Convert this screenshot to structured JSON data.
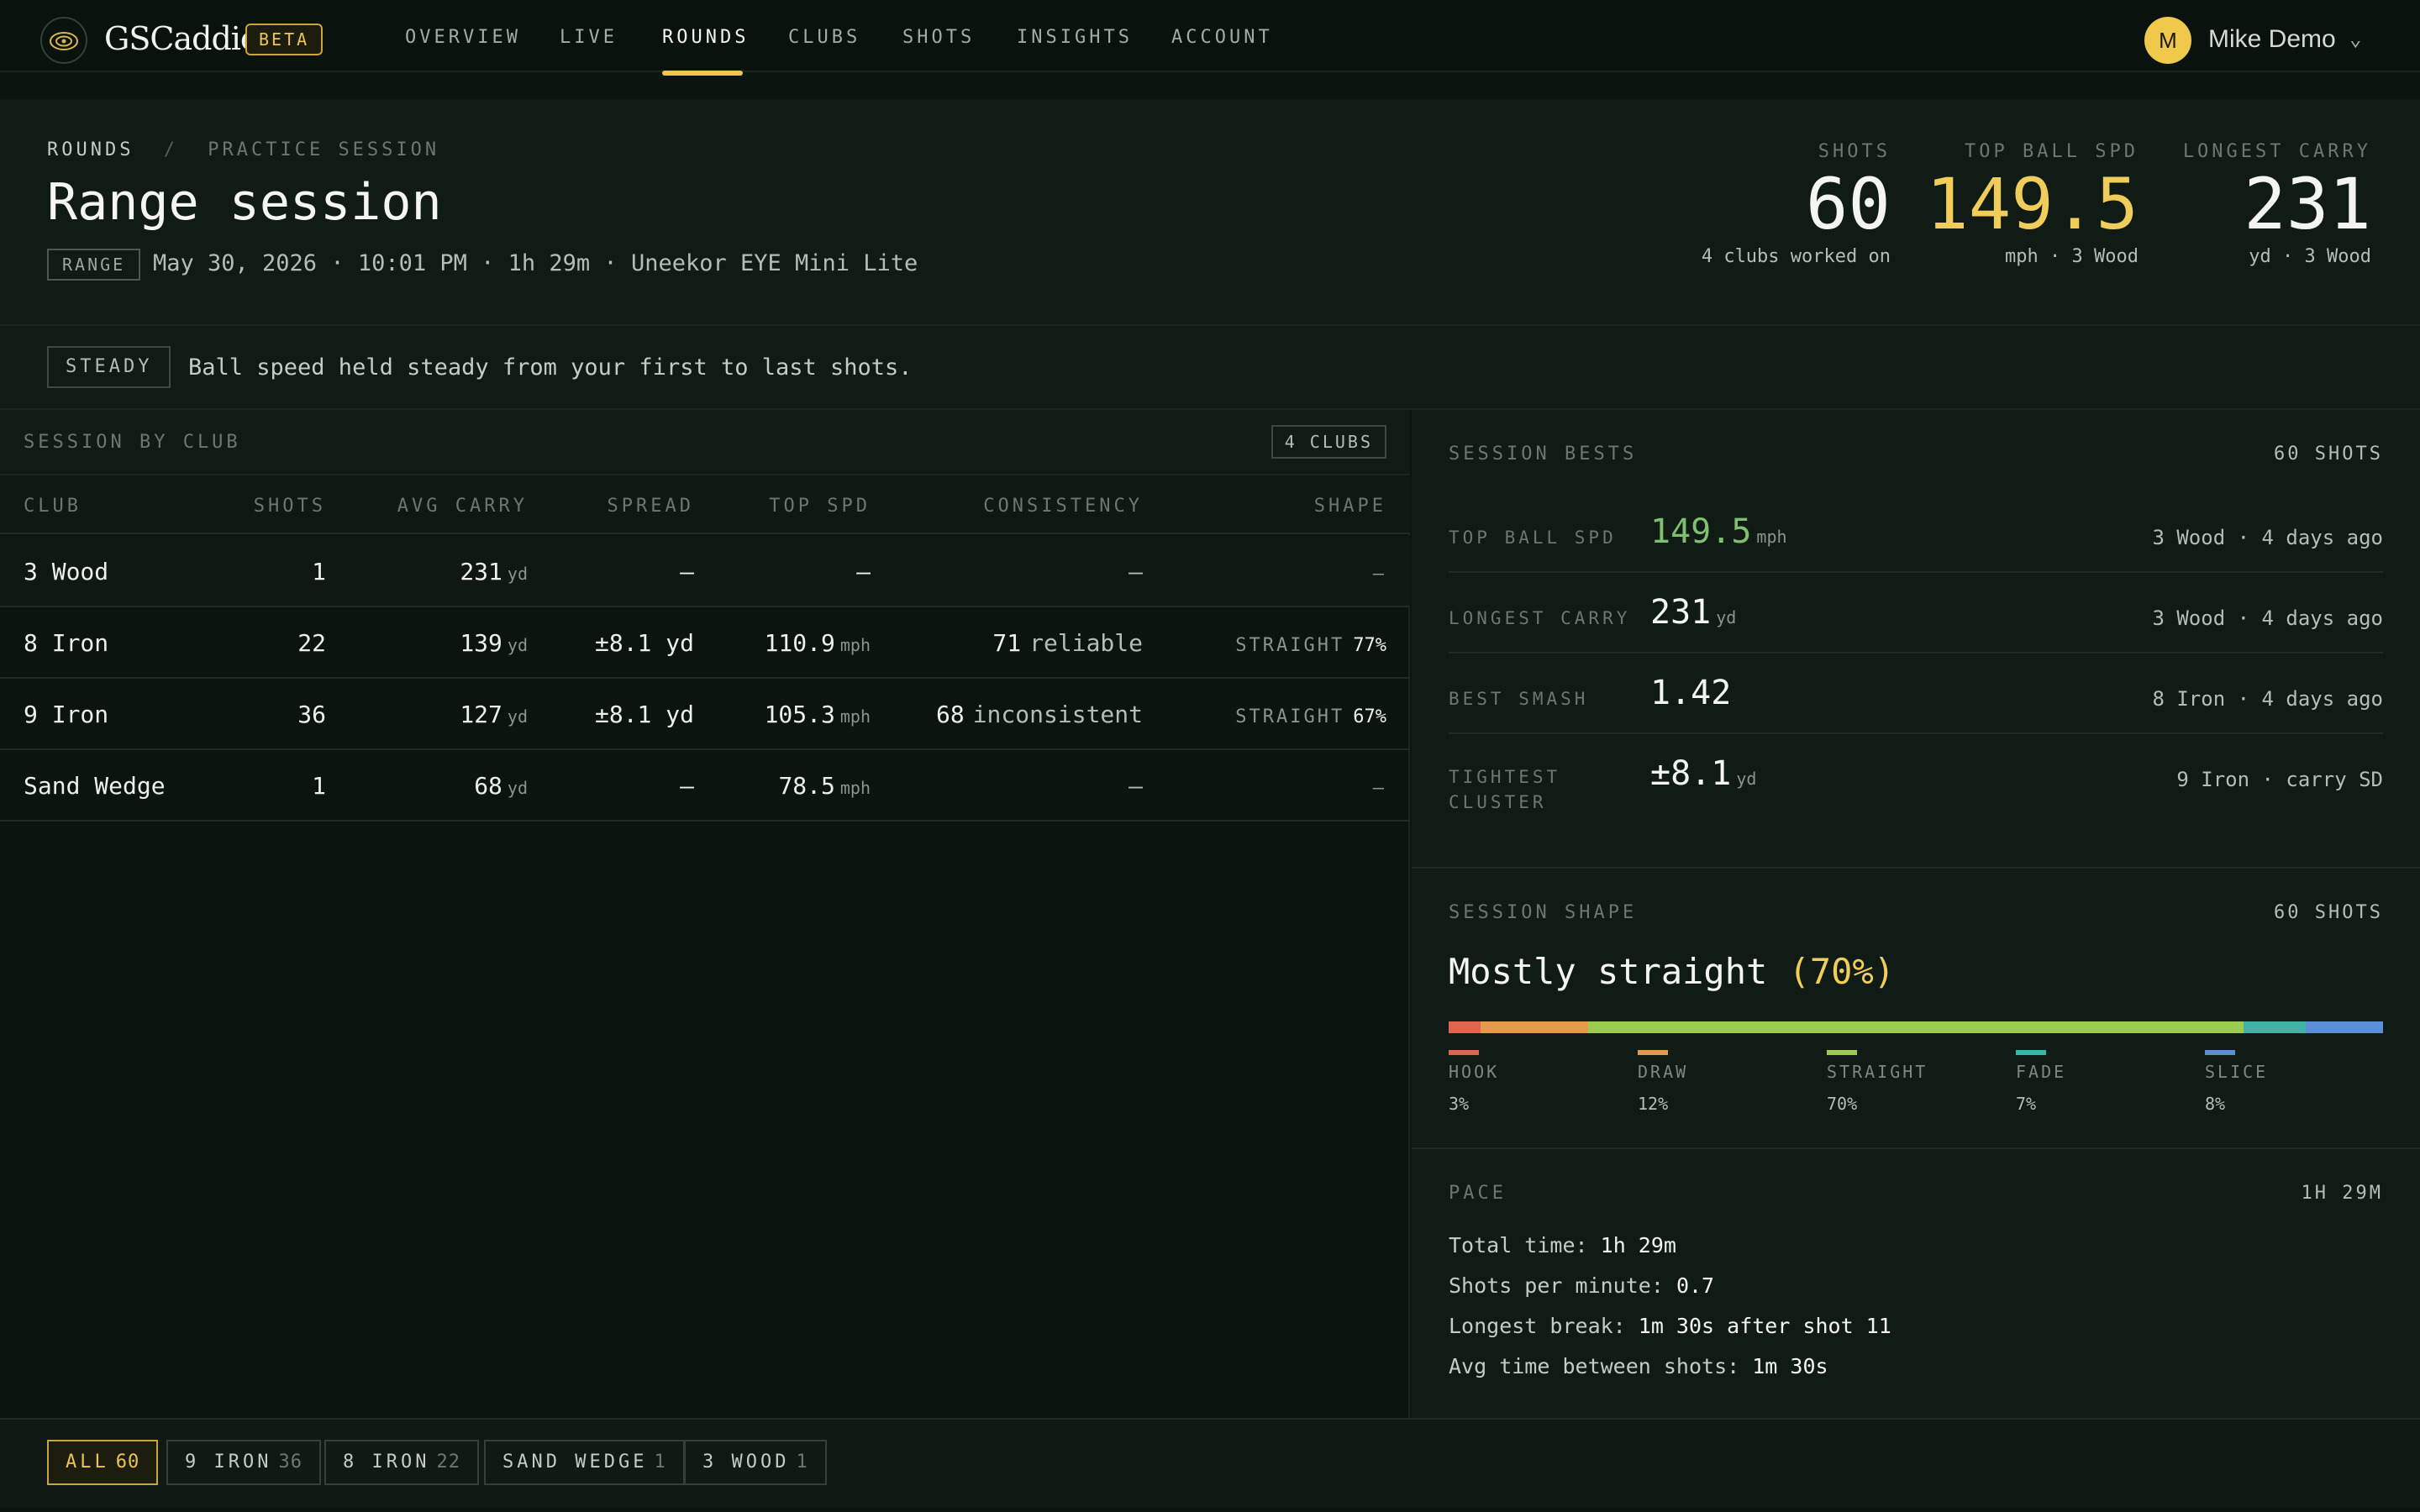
{
  "nav": {
    "brand": "GSCaddie",
    "beta": "BETA",
    "items": [
      "OVERVIEW",
      "LIVE",
      "ROUNDS",
      "CLUBS",
      "SHOTS",
      "INSIGHTS",
      "ACCOUNT"
    ],
    "active": "ROUNDS",
    "user": {
      "initial": "M",
      "name": "Mike Demo"
    }
  },
  "header": {
    "breadcrumb": [
      "ROUNDS",
      "PRACTICE SESSION"
    ],
    "title": "Range session",
    "badge": "RANGE",
    "meta": "May 30, 2026 · 10:01 PM · 1h 29m · Uneekor EYE Mini Lite",
    "stats": [
      {
        "label": "SHOTS",
        "value": "60",
        "sub": "4 clubs worked on",
        "color": "#f4f5f2"
      },
      {
        "label": "TOP BALL SPD",
        "value": "149.5",
        "sub": "mph · 3 Wood",
        "color": "#f0cd5b"
      },
      {
        "label": "LONGEST CARRY",
        "value": "231",
        "sub": "yd · 3 Wood",
        "color": "#f4f5f2"
      }
    ]
  },
  "banner": {
    "tag": "STEADY",
    "text": "Ball speed held steady from your first to last shots."
  },
  "club_table": {
    "title": "SESSION BY CLUB",
    "badge": "4 CLUBS",
    "columns": [
      "CLUB",
      "SHOTS",
      "AVG CARRY",
      "SPREAD",
      "TOP SPD",
      "CONSISTENCY",
      "SHAPE"
    ],
    "rows": [
      {
        "club": "3 Wood",
        "shots": "1",
        "carry": "231",
        "carry_unit": "yd",
        "spread": "–",
        "top": "–",
        "top_unit": "",
        "cons_num": "",
        "cons_text": "–",
        "shape": "",
        "shape_pct": "–"
      },
      {
        "club": "8 Iron",
        "shots": "22",
        "carry": "139",
        "carry_unit": "yd",
        "spread": "±8.1 yd",
        "top": "110.9",
        "top_unit": "mph",
        "cons_num": "71",
        "cons_text": "reliable",
        "shape": "STRAIGHT",
        "shape_pct": "77%"
      },
      {
        "club": "9 Iron",
        "shots": "36",
        "carry": "127",
        "carry_unit": "yd",
        "spread": "±8.1 yd",
        "top": "105.3",
        "top_unit": "mph",
        "cons_num": "68",
        "cons_text": "inconsistent",
        "shape": "STRAIGHT",
        "shape_pct": "67%"
      },
      {
        "club": "Sand Wedge",
        "shots": "1",
        "carry": "68",
        "carry_unit": "yd",
        "spread": "–",
        "top": "78.5",
        "top_unit": "mph",
        "cons_num": "",
        "cons_text": "–",
        "shape": "",
        "shape_pct": "–"
      }
    ]
  },
  "bests": {
    "title": "SESSION BESTS",
    "count": "60 SHOTS",
    "items": [
      {
        "label": "TOP BALL SPD",
        "value": "149.5",
        "unit": "mph",
        "ref": "3 Wood · 4 days ago",
        "color": "#7fbf6f"
      },
      {
        "label": "LONGEST CARRY",
        "value": "231",
        "unit": "yd",
        "ref": "3 Wood · 4 days ago",
        "color": "#f4f5f2"
      },
      {
        "label": "BEST SMASH",
        "value": "1.42",
        "unit": "",
        "ref": "8 Iron · 4 days ago",
        "color": "#f4f5f2"
      },
      {
        "label": "TIGHTEST CLUSTER",
        "value": "±8.1",
        "unit": "yd",
        "ref": "9 Iron · carry SD",
        "color": "#f4f5f2"
      }
    ]
  },
  "shape": {
    "title": "SESSION SHAPE",
    "count": "60 SHOTS",
    "headline": "Mostly straight",
    "headline_pct": "(70%)",
    "segments": [
      {
        "name": "HOOK",
        "pct": "3%",
        "share": 0.034,
        "color": "#e0654f"
      },
      {
        "name": "DRAW",
        "pct": "12%",
        "share": 0.115,
        "color": "#e39a4c"
      },
      {
        "name": "STRAIGHT",
        "pct": "70%",
        "share": 0.702,
        "color": "#9ccb52"
      },
      {
        "name": "FADE",
        "pct": "7%",
        "share": 0.066,
        "color": "#3fb3a6"
      },
      {
        "name": "SLICE",
        "pct": "8%",
        "share": 0.083,
        "color": "#5b8fd6"
      }
    ]
  },
  "pace": {
    "title": "PACE",
    "count": "1H 29M",
    "lines": [
      {
        "label": "Total time:",
        "value": "1h 29m"
      },
      {
        "label": "Shots per minute:",
        "value": "0.7"
      },
      {
        "label": "Longest break:",
        "value": "1m 30s after shot 11"
      },
      {
        "label": "Avg time between shots:",
        "value": "1m 30s"
      }
    ]
  },
  "filters": [
    {
      "label": "ALL",
      "count": "60",
      "active": true
    },
    {
      "label": "9 IRON",
      "count": "36",
      "active": false
    },
    {
      "label": "8 IRON",
      "count": "22",
      "active": false
    },
    {
      "label": "SAND WEDGE",
      "count": "1",
      "active": false
    },
    {
      "label": "3 WOOD",
      "count": "1",
      "active": false
    }
  ]
}
